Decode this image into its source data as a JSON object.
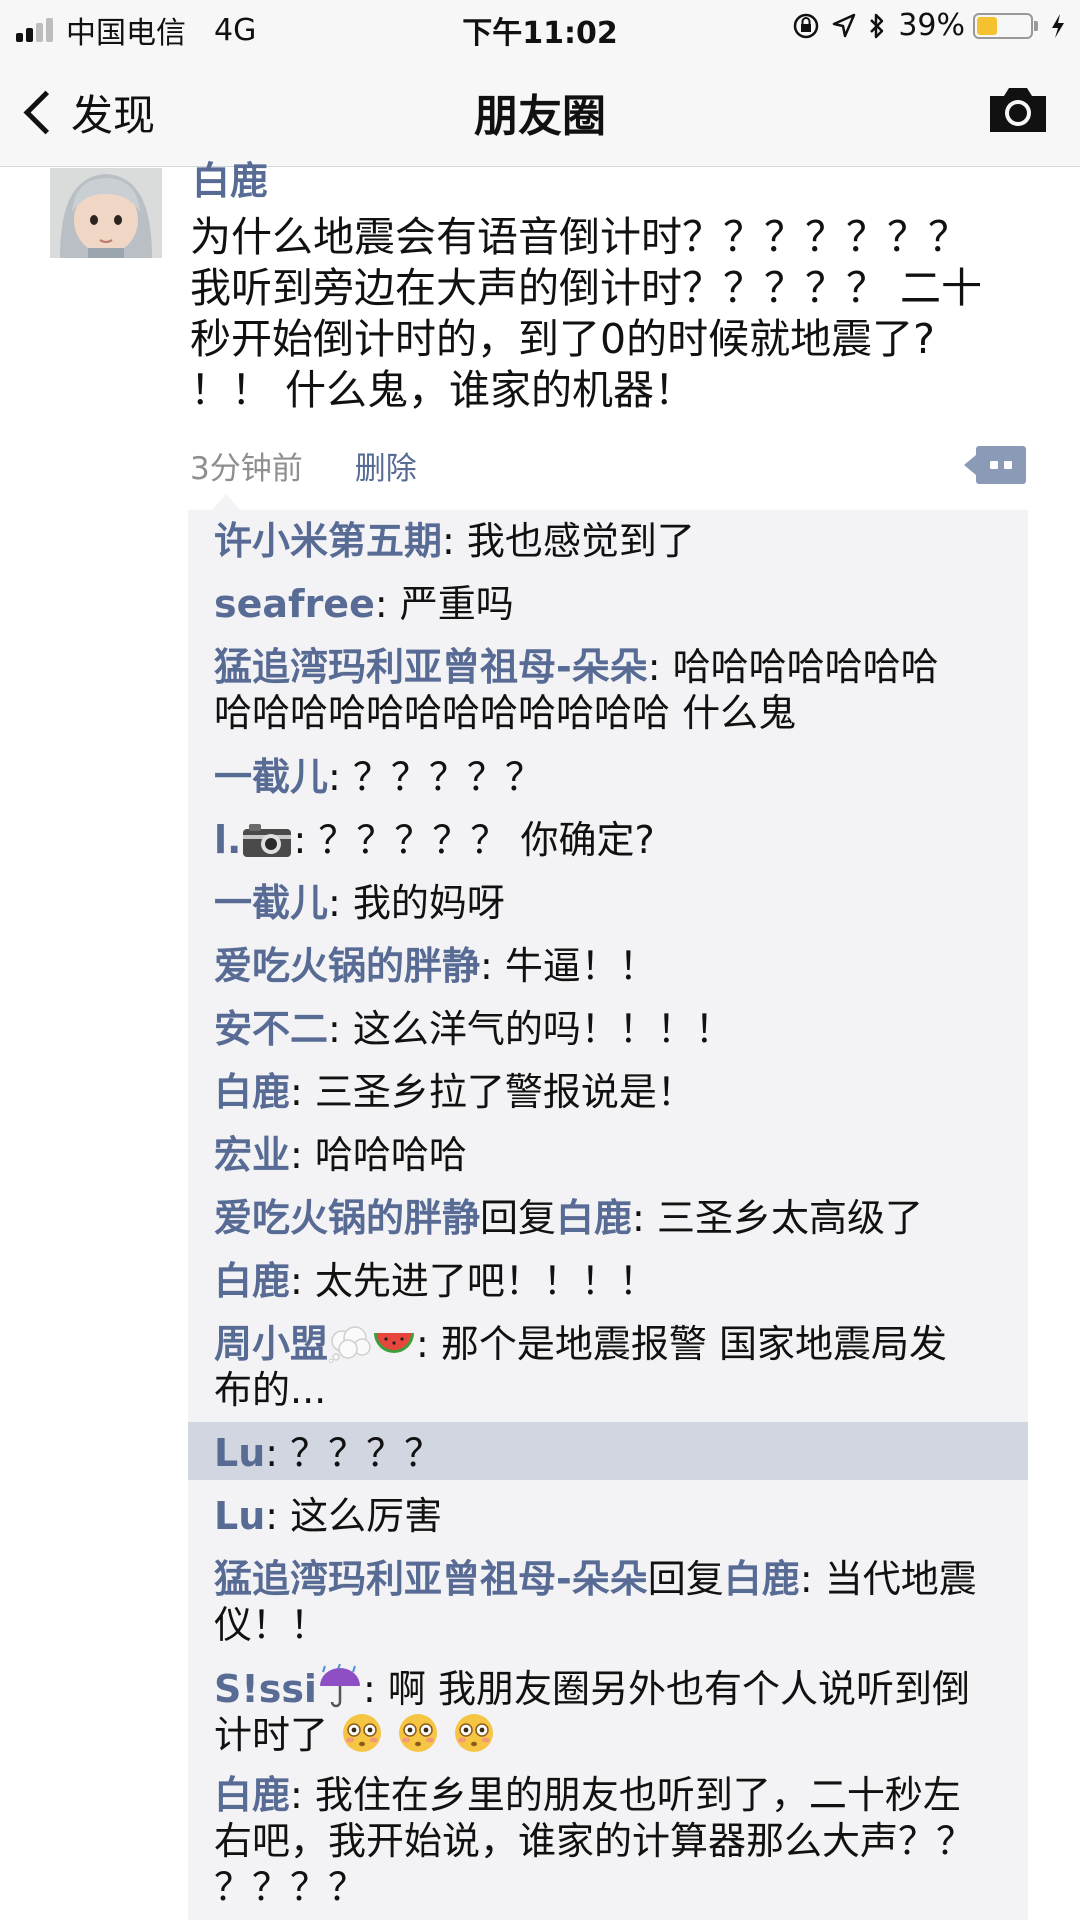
{
  "status_bar": {
    "carrier": "中国电信",
    "network": "4G",
    "time": "下午11:02",
    "battery": "39%",
    "battery_level": 0.39,
    "icons": [
      "signal-icon",
      "orientation-lock-icon",
      "location-icon",
      "bluetooth-icon",
      "battery-icon",
      "charging-icon"
    ]
  },
  "nav": {
    "back_label": "发现",
    "title": "朋友圈",
    "camera_icon": "camera-icon"
  },
  "post": {
    "author": "白鹿",
    "lines": [
      "为什么地震会有语音倒计时？？？？？？？",
      "我听到旁边在大声的倒计时？？？？？ 二十",
      "秒开始倒计时的，到了0的时候就地震了?",
      "！！ 什么鬼，谁家的机器！"
    ],
    "time": "3分钟前",
    "delete_label": "删除",
    "more_icon": "more-icon"
  },
  "comments": [
    {
      "name": "许小米第五期",
      "text": "我也感觉到了"
    },
    {
      "name": "seafree",
      "text": "严重吗"
    },
    {
      "name": "猛追湾玛利亚曾祖母-朵朵",
      "text": "哈哈哈哈哈哈哈",
      "text2": "哈哈哈哈哈哈哈哈哈哈哈哈 什么鬼"
    },
    {
      "name": "一截儿",
      "text": "？？？？？"
    },
    {
      "name": "l.",
      "name_icon": "camera-emoji",
      "text": "？？？？？ 你确定?"
    },
    {
      "name": "一截儿",
      "text": "我的妈呀"
    },
    {
      "name": "爱吃火锅的胖静",
      "text": "牛逼！！"
    },
    {
      "name": "安不二",
      "text": "这么洋气的吗！！！！"
    },
    {
      "name": "白鹿",
      "text": "三圣乡拉了警报说是！"
    },
    {
      "name": "宏业",
      "text": "哈哈哈哈"
    },
    {
      "name": "爱吃火锅的胖静",
      "reply_word": "回复",
      "reply_to": "白鹿",
      "text": "三圣乡太高级了"
    },
    {
      "name": "白鹿",
      "text": "太先进了吧！！！！"
    },
    {
      "name": "周小盟",
      "name_icons": [
        "thought-bubble-emoji",
        "watermelon-emoji"
      ],
      "text": "那个是地震报警 国家地震局发",
      "text2": "布的..."
    },
    {
      "name": "Lu",
      "text": "？？？？",
      "highlighted": true
    },
    {
      "name": "Lu",
      "text": "这么厉害"
    },
    {
      "name": "猛追湾玛利亚曾祖母-朵朵",
      "reply_word": "回复",
      "reply_to": "白鹿",
      "text": "当代地震",
      "text2": "仪！！"
    },
    {
      "name": "S!ssi",
      "name_icon": "umbrella-rain-emoji",
      "text": "啊 我朋友圈另外也有个人说听到倒",
      "text2": "计时了",
      "trail_icons": [
        "flushed-face-emoji",
        "flushed-face-emoji",
        "flushed-face-emoji"
      ]
    },
    {
      "name": "白鹿",
      "text": "我住在乡里的朋友也听到了，二十秒左",
      "text2": "右吧，我开始说，谁家的计算器那么大声？？",
      "text3": "？？？？"
    }
  ],
  "colors": {
    "link": "#576b95",
    "comment_bg": "#f3f3f5",
    "highlight_bg": "#d2d6e0",
    "bar_bg": "#f7f7f7"
  }
}
